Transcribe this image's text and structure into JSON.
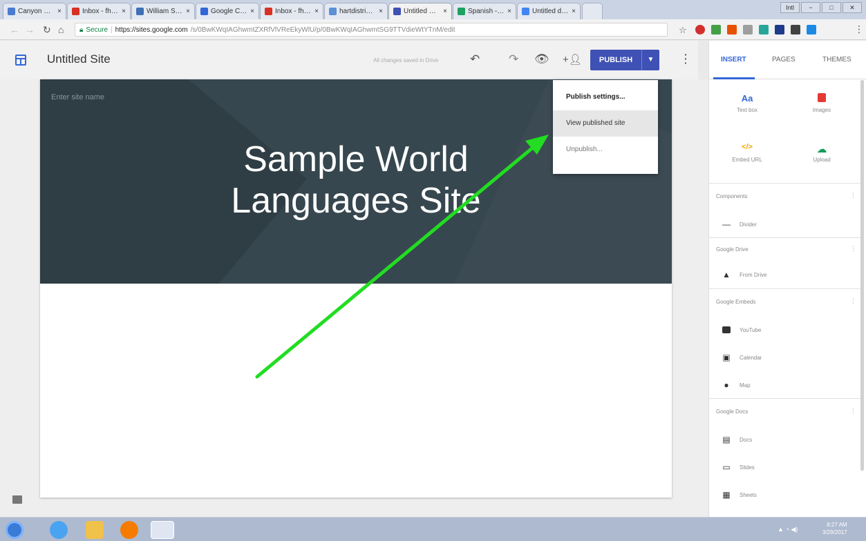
{
  "browser": {
    "tabs": [
      {
        "title": "Canyon High",
        "favicon_color": "#4a7bd0",
        "active": false
      },
      {
        "title": "Inbox - fhern",
        "favicon_color": "#d93025",
        "active": false
      },
      {
        "title": "William S. Ha",
        "favicon_color": "#3f6fb5",
        "active": false
      },
      {
        "title": "Google Cale",
        "favicon_color": "#3367d6",
        "active": false
      },
      {
        "title": "Inbox - fhern",
        "favicon_color": "#d93025",
        "active": false
      },
      {
        "title": "hartdistrict.o",
        "favicon_color": "#5b8fd6",
        "active": false
      },
      {
        "title": "Untitled Site",
        "favicon_color": "#3f51b5",
        "active": true
      },
      {
        "title": "Spanish - Goo",
        "favicon_color": "#1aa260",
        "active": false
      },
      {
        "title": "Untitled docu",
        "favicon_color": "#4285f4",
        "active": false
      }
    ],
    "tab_close": "×",
    "window_controls": [
      "Intl",
      "−",
      "□",
      "✕"
    ],
    "address": {
      "secure_label": "Secure",
      "host": "https://sites.google.com",
      "path": "/s/0BwKWqIAGhwmtZXRfVlVReEkyWlU/p/0BwKWqIAGhwmtSG9TTVdieWtYTnM/edit"
    }
  },
  "app": {
    "title": "Untitled Site",
    "save_status": "All changes saved in Drive",
    "publish_label": "PUBLISH",
    "publish_menu": [
      {
        "label": "Publish settings..."
      },
      {
        "label": "View published site"
      },
      {
        "label": "Unpublish..."
      }
    ]
  },
  "hero": {
    "site_name_placeholder": "Enter site name",
    "title_line1": "Sample World",
    "title_line2": "Languages Site"
  },
  "panel": {
    "tabs": [
      "INSERT",
      "PAGES",
      "THEMES"
    ],
    "tools": [
      {
        "label": "Text box",
        "icon": "Aa",
        "color": "#3367d6"
      },
      {
        "label": "Images",
        "icon": "image-icon",
        "color": "#e53935"
      },
      {
        "label": "Embed URL",
        "icon": "</>",
        "color": "#f4a700"
      },
      {
        "label": "Upload",
        "icon": "cloud-upload-icon",
        "color": "#0f9d58"
      }
    ],
    "sections": [
      {
        "title": "Components",
        "items": [
          {
            "label": "Divider",
            "icon": "divider-icon"
          }
        ]
      },
      {
        "title": "Google Drive",
        "items": [
          {
            "label": "From Drive",
            "icon": "drive-icon"
          }
        ]
      },
      {
        "title": "Google Embeds",
        "items": [
          {
            "label": "YouTube",
            "icon": "youtube-icon"
          },
          {
            "label": "Calendar",
            "icon": "calendar-icon"
          },
          {
            "label": "Map",
            "icon": "map-pin-icon"
          }
        ]
      },
      {
        "title": "Google Docs",
        "items": [
          {
            "label": "Docs",
            "icon": "docs-icon"
          },
          {
            "label": "Slides",
            "icon": "slides-icon"
          },
          {
            "label": "Sheets",
            "icon": "sheets-icon"
          }
        ]
      }
    ]
  },
  "taskbar": {
    "time": "8:27 AM",
    "date": "3/29/2017"
  },
  "annotation": {
    "arrow_color": "#22dd22"
  }
}
